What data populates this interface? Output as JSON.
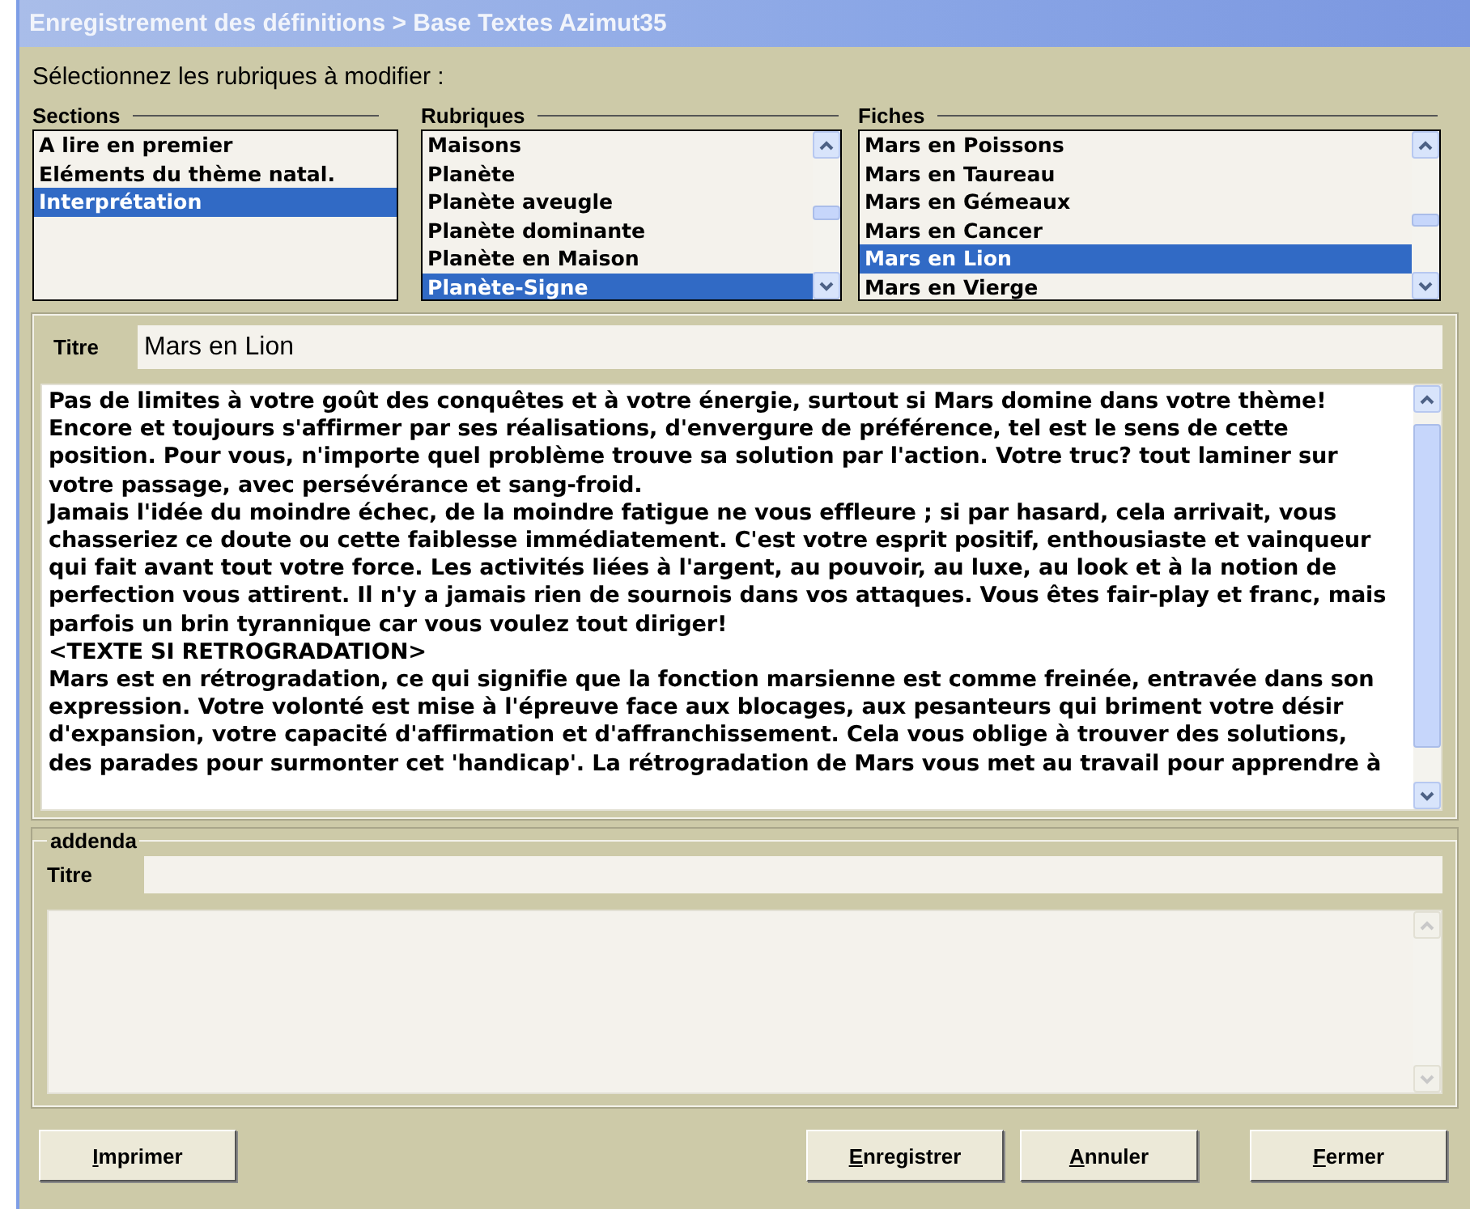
{
  "window": {
    "title": "Enregistrement des définitions > Base Textes Azimut35"
  },
  "heading": "Sélectionnez les rubriques à modifier :",
  "lists": [
    {
      "label": "Sections",
      "scrollbar": false,
      "items": [
        {
          "text": "A lire en premier",
          "selected": false
        },
        {
          "text": "Eléments du thème natal.",
          "selected": false
        },
        {
          "text": "Interprétation",
          "selected": true
        }
      ]
    },
    {
      "label": "Rubriques",
      "scrollbar": true,
      "items": [
        {
          "text": "Maisons",
          "selected": false
        },
        {
          "text": "Planète",
          "selected": false
        },
        {
          "text": "Planète aveugle",
          "selected": false
        },
        {
          "text": "Planète dominante",
          "selected": false
        },
        {
          "text": "Planète en Maison",
          "selected": false
        },
        {
          "text": "Planète-Signe",
          "selected": true
        }
      ]
    },
    {
      "label": "Fiches",
      "scrollbar": true,
      "items": [
        {
          "text": "Mars en Poissons",
          "selected": false
        },
        {
          "text": "Mars en Taureau",
          "selected": false
        },
        {
          "text": "Mars en Gémeaux",
          "selected": false
        },
        {
          "text": "Mars en Cancer",
          "selected": false
        },
        {
          "text": "Mars en Lion",
          "selected": true
        },
        {
          "text": "Mars en Vierge",
          "selected": false
        }
      ]
    }
  ],
  "main": {
    "title_label": "Titre",
    "title_value": "Mars en Lion",
    "text_lines": [
      "Pas de limites à votre goût des conquêtes et à votre énergie, surtout si Mars domine dans votre thème!",
      "Encore et toujours s'affirmer par ses réalisations, d'envergure de préférence, tel est le sens de cette",
      "position. Pour vous, n'importe quel problème trouve sa solution par l'action. Votre truc? tout laminer sur",
      "votre passage, avec persévérance et sang-froid.",
      "Jamais l'idée du moindre échec, de la moindre fatigue ne vous effleure ; si par hasard, cela arrivait, vous",
      "chasseriez ce doute ou cette faiblesse immédiatement. C'est votre esprit positif, enthousiaste et vainqueur",
      "qui fait avant tout votre force. Les activités liées à l'argent, au pouvoir, au luxe, au look et à la notion de",
      "perfection vous attirent. Il n'y a jamais rien de sournois dans vos attaques. Vous êtes fair-play et franc, mais",
      "parfois un brin tyrannique car vous voulez tout diriger!",
      "<TEXTE SI RETROGRADATION>",
      "Mars est en rétrogradation, ce qui signifie que la fonction marsienne est comme freinée, entravée dans son",
      "expression. Votre volonté est mise à l'épreuve face aux blocages, aux pesanteurs qui briment votre désir",
      "d'expansion, votre capacité d'affirmation et d'affranchissement. Cela vous oblige à trouver des solutions,",
      "des parades pour surmonter cet 'handicap'. La rétrogradation de Mars vous met au travail pour apprendre à"
    ],
    "disabled": false
  },
  "addenda": {
    "legend": "addenda",
    "title_label": "Titre",
    "disabled": true
  },
  "buttons": [
    {
      "label": "Imprimer",
      "underline_first": true
    },
    {
      "label": "Enregistrer",
      "underline_first": true
    },
    {
      "label": "Annuler",
      "underline_first": true
    },
    {
      "label": "Fermer",
      "underline_first": true
    }
  ]
}
